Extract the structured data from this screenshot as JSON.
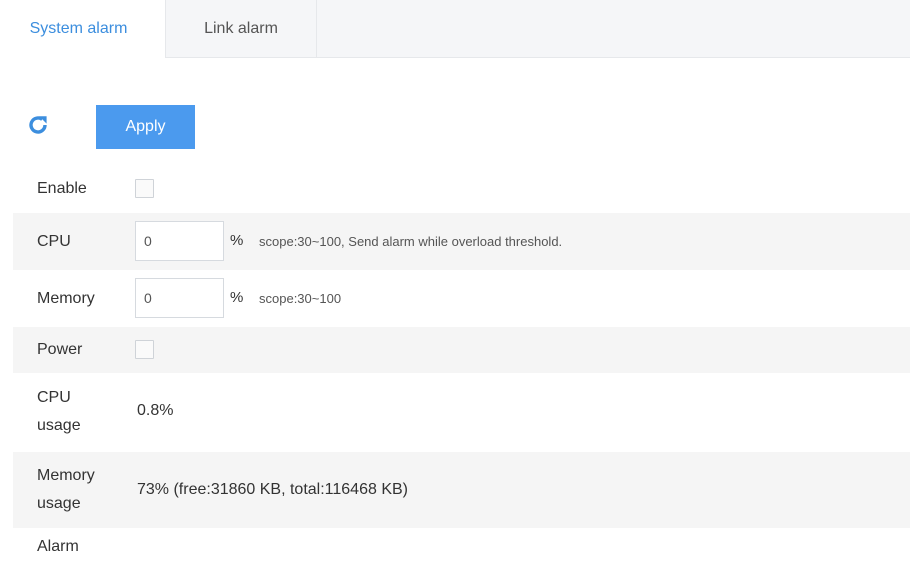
{
  "tabs": {
    "system_alarm": "System alarm",
    "link_alarm": "Link alarm"
  },
  "toolbar": {
    "refresh_icon": "refresh-icon",
    "apply_label": "Apply"
  },
  "form": {
    "enable": {
      "label": "Enable",
      "checked": false
    },
    "cpu": {
      "label": "CPU",
      "value": "0",
      "unit": "%",
      "hint": "scope:30~100, Send alarm while overload threshold."
    },
    "memory": {
      "label": "Memory",
      "value": "0",
      "unit": "%",
      "hint": "scope:30~100"
    },
    "power": {
      "label": "Power",
      "checked": false
    },
    "cpu_usage": {
      "label_line1": "CPU",
      "label_line2": "usage",
      "value": "0.8%"
    },
    "memory_usage": {
      "label_line1": "Memory",
      "label_line2": "usage",
      "value": "73% (free:31860 KB, total:116468 KB)"
    },
    "alarm": {
      "label": "Alarm"
    }
  },
  "colors": {
    "accent": "#3c8ede",
    "button": "#4b9aee",
    "row_shade": "#f5f5f5"
  }
}
